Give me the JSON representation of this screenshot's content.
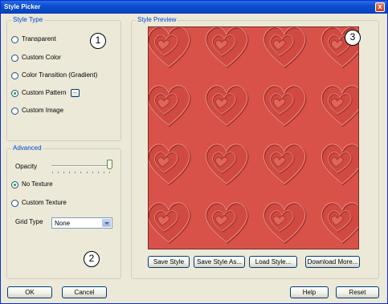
{
  "window": {
    "title": "Style Picker",
    "close_glyph": "x"
  },
  "style_type": {
    "legend": "Style Type",
    "options": [
      {
        "label": "Transparent",
        "checked": false
      },
      {
        "label": "Custom Color",
        "checked": false
      },
      {
        "label": "Color Transition (Gradient)",
        "checked": false
      },
      {
        "label": "Custom Pattern",
        "checked": true
      },
      {
        "label": "Custom Image",
        "checked": false
      }
    ],
    "pattern_button_label": "..."
  },
  "advanced": {
    "legend": "Advanced",
    "opacity_label": "Opacity",
    "opacity_value": 1.0,
    "texture_options": [
      {
        "label": "No Texture",
        "checked": true
      },
      {
        "label": "Custom Texture",
        "checked": false
      }
    ],
    "grid_type_label": "Grid Type",
    "grid_type_value": "None"
  },
  "preview": {
    "legend": "Style Preview",
    "pattern_color": "#d84f47",
    "buttons": [
      "Save Style",
      "Save Style As...",
      "Load Style...",
      "Download More..."
    ]
  },
  "footer": {
    "ok": "OK",
    "cancel": "Cancel",
    "help": "Help",
    "reset": "Reset"
  },
  "badges": [
    "1",
    "2",
    "3"
  ]
}
